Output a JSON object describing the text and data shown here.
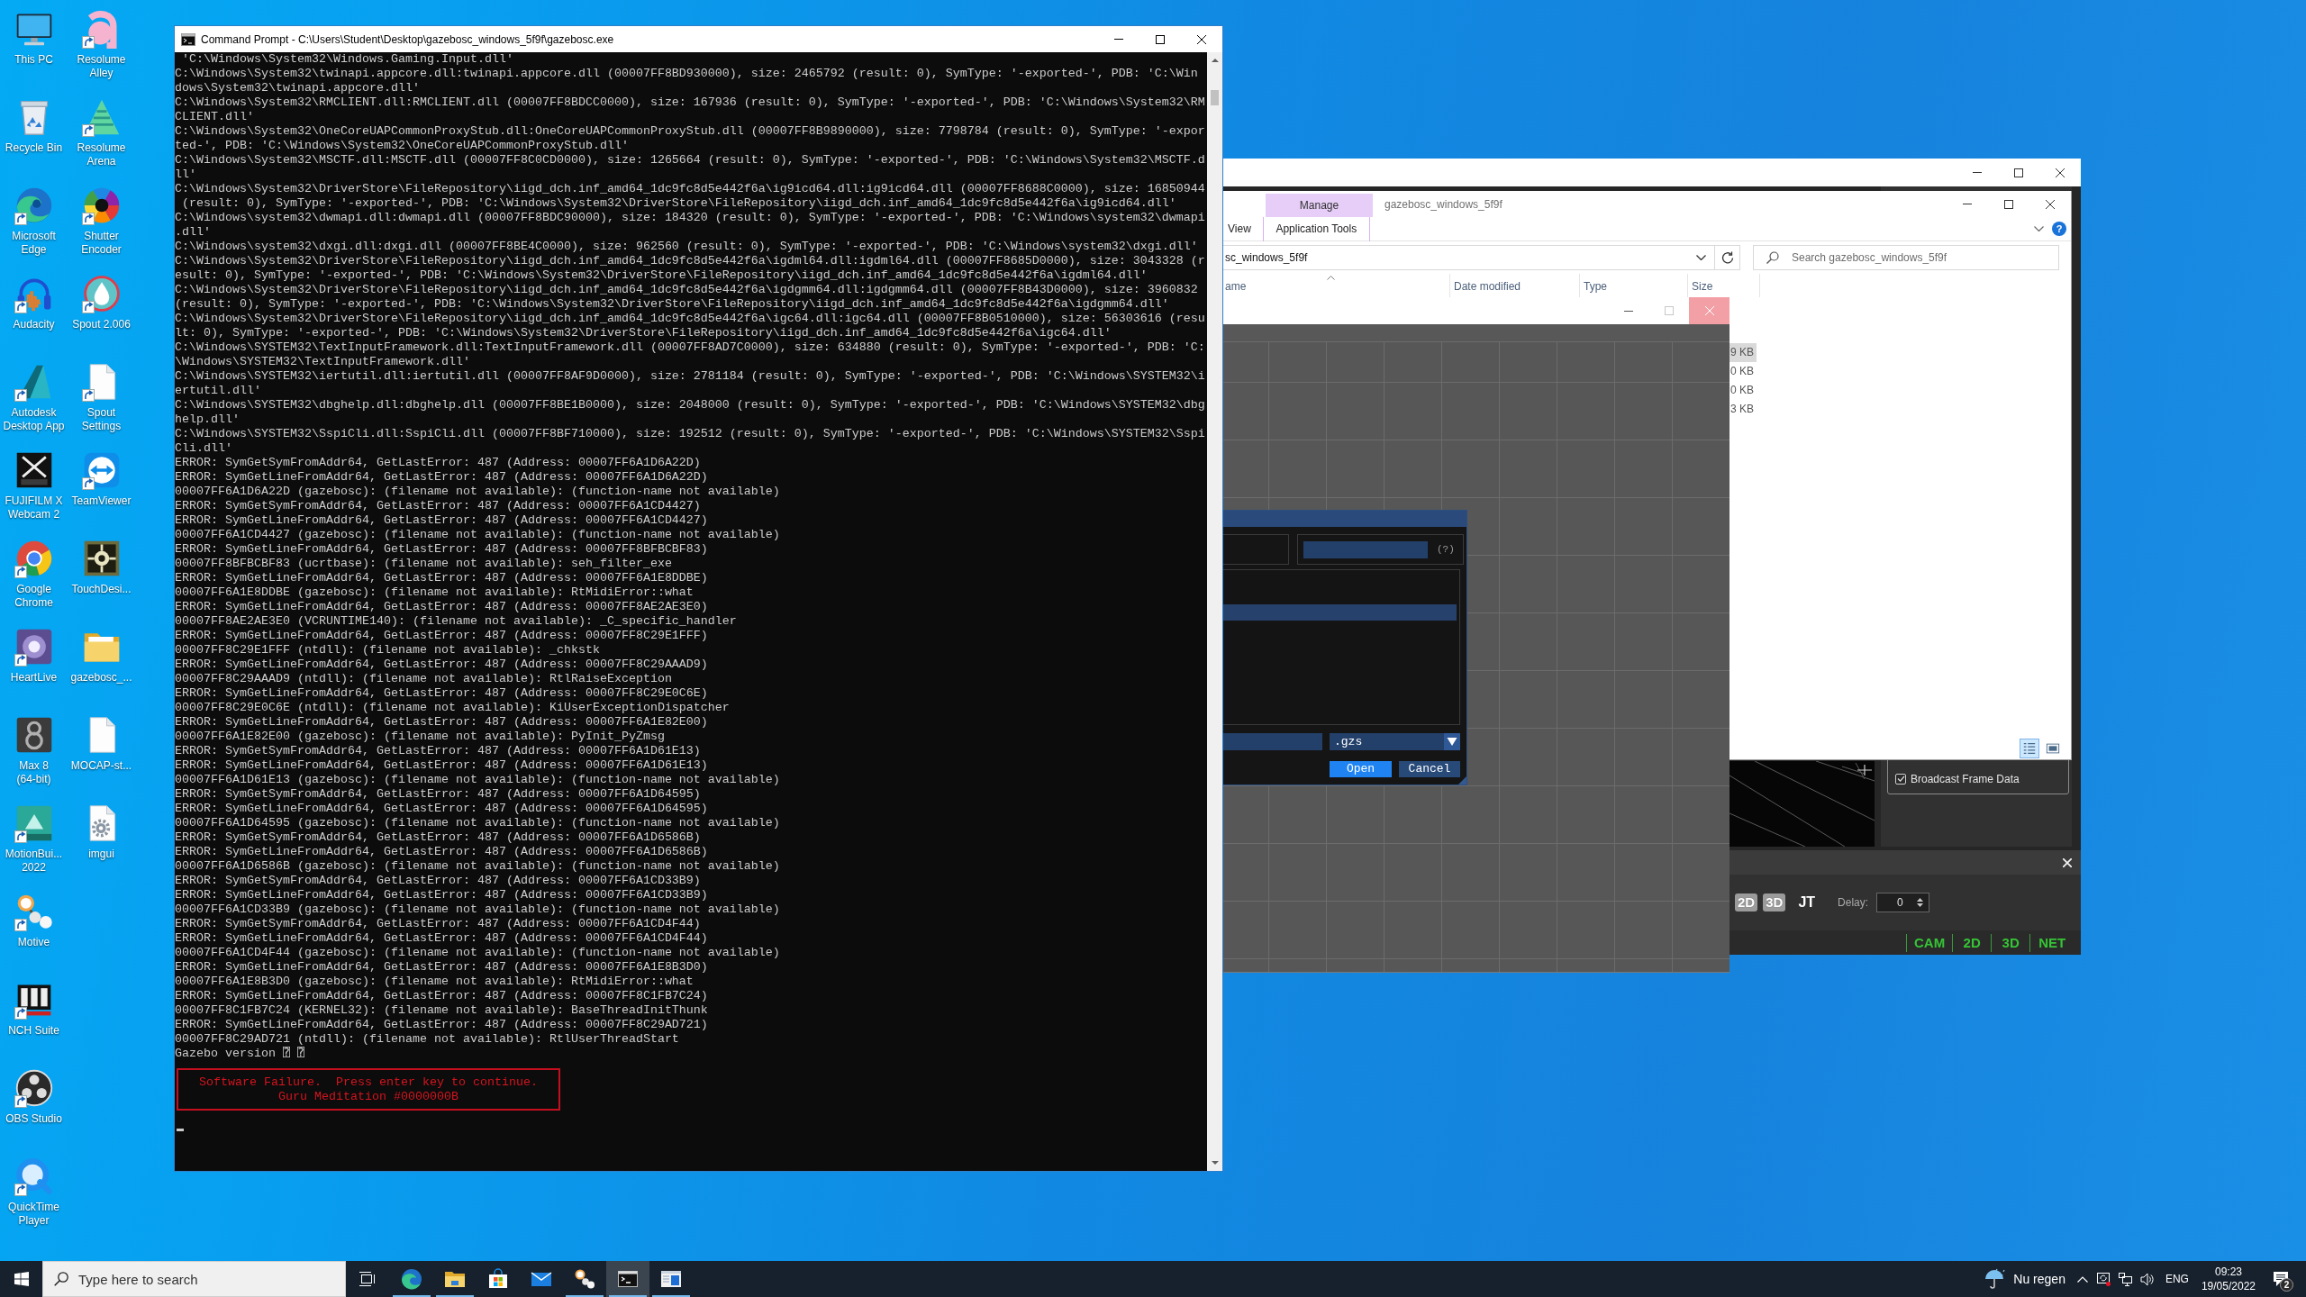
{
  "desktop_icons": [
    {
      "label": "This PC",
      "shortcut": false
    },
    {
      "label": "Recycle Bin",
      "shortcut": false
    },
    {
      "label": "Microsoft Edge",
      "shortcut": true
    },
    {
      "label": "Audacity",
      "shortcut": true
    },
    {
      "label": "Autodesk Desktop App",
      "shortcut": true
    },
    {
      "label": "FUJIFILM X Webcam 2",
      "shortcut": false
    },
    {
      "label": "Google Chrome",
      "shortcut": true
    },
    {
      "label": "HeartLive",
      "shortcut": true
    },
    {
      "label": "Max 8 (64-bit)",
      "shortcut": false
    },
    {
      "label": "MotionBui... 2022",
      "shortcut": true
    },
    {
      "label": "Motive",
      "shortcut": true
    },
    {
      "label": "NCH Suite",
      "shortcut": true
    },
    {
      "label": "OBS Studio",
      "shortcut": true
    },
    {
      "label": "QuickTime Player",
      "shortcut": true
    },
    {
      "label": "Resolume Alley",
      "shortcut": true
    },
    {
      "label": "Resolume Arena",
      "shortcut": true
    },
    {
      "label": "Shutter Encoder",
      "shortcut": true
    },
    {
      "label": "Spout 2.006",
      "shortcut": true
    },
    {
      "label": "Spout Settings",
      "shortcut": true
    },
    {
      "label": "TeamViewer",
      "shortcut": true
    },
    {
      "label": "TouchDesi...",
      "shortcut": false
    },
    {
      "label": "gazebosc_...",
      "shortcut": false
    },
    {
      "label": "MOCAP-st...",
      "shortcut": false
    },
    {
      "label": "imgui",
      "shortcut": false
    }
  ],
  "console": {
    "title": "Command Prompt - C:\\Users\\Student\\Desktop\\gazebosc_windows_5f9f\\gazebosc.exe",
    "lines": [
      " 'C:\\Windows\\System32\\Windows.Gaming.Input.dll'",
      "C:\\Windows\\System32\\twinapi.appcore.dll:twinapi.appcore.dll (00007FF8BD930000), size: 2465792 (result: 0), SymType: '-exported-', PDB: 'C:\\Win",
      "dows\\System32\\twinapi.appcore.dll'",
      "C:\\Windows\\System32\\RMCLIENT.dll:RMCLIENT.dll (00007FF8BDCC0000), size: 167936 (result: 0), SymType: '-exported-', PDB: 'C:\\Windows\\System32\\RM",
      "CLIENT.dll'",
      "C:\\Windows\\System32\\OneCoreUAPCommonProxyStub.dll:OneCoreUAPCommonProxyStub.dll (00007FF8B9890000), size: 7798784 (result: 0), SymType: '-expor",
      "ted-', PDB: 'C:\\Windows\\System32\\OneCoreUAPCommonProxyStub.dll'",
      "C:\\Windows\\System32\\MSCTF.dll:MSCTF.dll (00007FF8C0CD0000), size: 1265664 (result: 0), SymType: '-exported-', PDB: 'C:\\Windows\\System32\\MSCTF.d",
      "ll'",
      "C:\\Windows\\System32\\DriverStore\\FileRepository\\iigd_dch.inf_amd64_1dc9fc8d5e442f6a\\ig9icd64.dll:ig9icd64.dll (00007FF8688C0000), size: 16850944",
      " (result: 0), SymType: '-exported-', PDB: 'C:\\Windows\\System32\\DriverStore\\FileRepository\\iigd_dch.inf_amd64_1dc9fc8d5e442f6a\\ig9icd64.dll'",
      "C:\\Windows\\system32\\dwmapi.dll:dwmapi.dll (00007FF8BDC90000), size: 184320 (result: 0), SymType: '-exported-', PDB: 'C:\\Windows\\system32\\dwmapi",
      ".dll'",
      "C:\\Windows\\system32\\dxgi.dll:dxgi.dll (00007FF8BE4C0000), size: 962560 (result: 0), SymType: '-exported-', PDB: 'C:\\Windows\\system32\\dxgi.dll'",
      "C:\\Windows\\System32\\DriverStore\\FileRepository\\iigd_dch.inf_amd64_1dc9fc8d5e442f6a\\igdml64.dll:igdml64.dll (00007FF8685D0000), size: 3043328 (r",
      "esult: 0), SymType: '-exported-', PDB: 'C:\\Windows\\System32\\DriverStore\\FileRepository\\iigd_dch.inf_amd64_1dc9fc8d5e442f6a\\igdml64.dll'",
      "C:\\Windows\\System32\\DriverStore\\FileRepository\\iigd_dch.inf_amd64_1dc9fc8d5e442f6a\\igdgmm64.dll:igdgmm64.dll (00007FF8B43D0000), size: 3960832",
      "(result: 0), SymType: '-exported-', PDB: 'C:\\Windows\\System32\\DriverStore\\FileRepository\\iigd_dch.inf_amd64_1dc9fc8d5e442f6a\\igdgmm64.dll'",
      "C:\\Windows\\System32\\DriverStore\\FileRepository\\iigd_dch.inf_amd64_1dc9fc8d5e442f6a\\igc64.dll:igc64.dll (00007FF8B0510000), size: 56303616 (resu",
      "lt: 0), SymType: '-exported-', PDB: 'C:\\Windows\\System32\\DriverStore\\FileRepository\\iigd_dch.inf_amd64_1dc9fc8d5e442f6a\\igc64.dll'",
      "C:\\Windows\\SYSTEM32\\TextInputFramework.dll:TextInputFramework.dll (00007FF8AD7C0000), size: 634880 (result: 0), SymType: '-exported-', PDB: 'C:",
      "\\Windows\\SYSTEM32\\TextInputFramework.dll'",
      "C:\\Windows\\SYSTEM32\\iertutil.dll:iertutil.dll (00007FF8AF9D0000), size: 2781184 (result: 0), SymType: '-exported-', PDB: 'C:\\Windows\\SYSTEM32\\i",
      "ertutil.dll'",
      "C:\\Windows\\SYSTEM32\\dbghelp.dll:dbghelp.dll (00007FF8BE1B0000), size: 2048000 (result: 0), SymType: '-exported-', PDB: 'C:\\Windows\\SYSTEM32\\dbg",
      "help.dll'",
      "C:\\Windows\\SYSTEM32\\SspiCli.dll:SspiCli.dll (00007FF8BF710000), size: 192512 (result: 0), SymType: '-exported-', PDB: 'C:\\Windows\\SYSTEM32\\Sspi",
      "Cli.dll'",
      "ERROR: SymGetSymFromAddr64, GetLastError: 487 (Address: 00007FF6A1D6A22D)",
      "ERROR: SymGetLineFromAddr64, GetLastError: 487 (Address: 00007FF6A1D6A22D)",
      "00007FF6A1D6A22D (gazebosc): (filename not available): (function-name not available)",
      "ERROR: SymGetSymFromAddr64, GetLastError: 487 (Address: 00007FF6A1CD4427)",
      "ERROR: SymGetLineFromAddr64, GetLastError: 487 (Address: 00007FF6A1CD4427)",
      "00007FF6A1CD4427 (gazebosc): (filename not available): (function-name not available)",
      "ERROR: SymGetLineFromAddr64, GetLastError: 487 (Address: 00007FF8BFBCBF83)",
      "00007FF8BFBCBF83 (ucrtbase): (filename not available): seh_filter_exe",
      "ERROR: SymGetLineFromAddr64, GetLastError: 487 (Address: 00007FF6A1E8DDBE)",
      "00007FF6A1E8DDBE (gazebosc): (filename not available): RtMidiError::what",
      "ERROR: SymGetLineFromAddr64, GetLastError: 487 (Address: 00007FF8AE2AE3E0)",
      "00007FF8AE2AE3E0 (VCRUNTIME140): (filename not available): _C_specific_handler",
      "ERROR: SymGetLineFromAddr64, GetLastError: 487 (Address: 00007FF8C29E1FFF)",
      "00007FF8C29E1FFF (ntdll): (filename not available): _chkstk",
      "ERROR: SymGetLineFromAddr64, GetLastError: 487 (Address: 00007FF8C29AAAD9)",
      "00007FF8C29AAAD9 (ntdll): (filename not available): RtlRaiseException",
      "ERROR: SymGetLineFromAddr64, GetLastError: 487 (Address: 00007FF8C29E0C6E)",
      "00007FF8C29E0C6E (ntdll): (filename not available): KiUserExceptionDispatcher",
      "ERROR: SymGetLineFromAddr64, GetLastError: 487 (Address: 00007FF6A1E82E00)",
      "00007FF6A1E82E00 (gazebosc): (filename not available): PyInit_PyZmsg",
      "ERROR: SymGetSymFromAddr64, GetLastError: 487 (Address: 00007FF6A1D61E13)",
      "ERROR: SymGetLineFromAddr64, GetLastError: 487 (Address: 00007FF6A1D61E13)",
      "00007FF6A1D61E13 (gazebosc): (filename not available): (function-name not available)",
      "ERROR: SymGetSymFromAddr64, GetLastError: 487 (Address: 00007FF6A1D64595)",
      "ERROR: SymGetLineFromAddr64, GetLastError: 487 (Address: 00007FF6A1D64595)",
      "00007FF6A1D64595 (gazebosc): (filename not available): (function-name not available)",
      "ERROR: SymGetSymFromAddr64, GetLastError: 487 (Address: 00007FF6A1D6586B)",
      "ERROR: SymGetLineFromAddr64, GetLastError: 487 (Address: 00007FF6A1D6586B)",
      "00007FF6A1D6586B (gazebosc): (filename not available): (function-name not available)",
      "ERROR: SymGetSymFromAddr64, GetLastError: 487 (Address: 00007FF6A1CD33B9)",
      "ERROR: SymGetLineFromAddr64, GetLastError: 487 (Address: 00007FF6A1CD33B9)",
      "00007FF6A1CD33B9 (gazebosc): (filename not available): (function-name not available)",
      "ERROR: SymGetSymFromAddr64, GetLastError: 487 (Address: 00007FF6A1CD4F44)",
      "ERROR: SymGetLineFromAddr64, GetLastError: 487 (Address: 00007FF6A1CD4F44)",
      "00007FF6A1CD4F44 (gazebosc): (filename not available): (function-name not available)",
      "ERROR: SymGetLineFromAddr64, GetLastError: 487 (Address: 00007FF6A1E8B3D0)",
      "00007FF6A1E8B3D0 (gazebosc): (filename not available): RtMidiError::what",
      "ERROR: SymGetLineFromAddr64, GetLastError: 487 (Address: 00007FF8C1FB7C24)",
      "00007FF8C1FB7C24 (KERNEL32): (filename not available): BaseThreadInitThunk",
      "ERROR: SymGetLineFromAddr64, GetLastError: 487 (Address: 00007FF8C29AD721)",
      "00007FF8C29AD721 (ntdll): (filename not available): RtlUserThreadStart",
      "Gazebo version ⍰ ⍰"
    ],
    "alert": [
      "Software Failure.  Press enter key to continue.",
      "Guru Meditation #0000000B"
    ]
  },
  "app_window": {
    "broadcast_frame_data": {
      "label": "Broadcast Frame Data",
      "checked": true
    },
    "view_buttons": [
      {
        "label": "2D",
        "on": true
      },
      {
        "label": "3D",
        "on": true
      },
      {
        "label": "JT",
        "on": false
      }
    ],
    "delay": {
      "label": "Delay:",
      "value": "0"
    },
    "status": [
      "CAM",
      "2D",
      "3D",
      "NET"
    ]
  },
  "explorer": {
    "context_tab": "Manage",
    "title": "gazebosc_windows_5f9f",
    "tabs": [
      {
        "label": "View",
        "kind": "standard"
      },
      {
        "label": "Application Tools",
        "kind": "contextual"
      }
    ],
    "help": "?",
    "address": "sc_windows_5f9f",
    "search": {
      "placeholder": "Search gazebosc_windows_5f9f"
    },
    "columns": [
      "ame",
      "Date modified",
      "Type",
      "Size"
    ],
    "sizes": [
      {
        "text": "9 KB",
        "selected": true
      },
      {
        "text": "0 KB",
        "selected": false
      },
      {
        "text": "0 KB",
        "selected": false
      },
      {
        "text": "3 KB",
        "selected": false
      }
    ],
    "views": [
      {
        "selected": true
      },
      {
        "selected": false
      }
    ]
  },
  "node_window": {
    "file_dialog": {
      "help": "(?)",
      "rows": [
        {
          "selected": true
        }
      ],
      "file_type": ".gzs",
      "buttons": [
        {
          "label": "Open",
          "highlighted": true
        },
        {
          "label": "Cancel",
          "highlighted": false
        }
      ]
    }
  },
  "taskbar": {
    "search": {
      "placeholder": "Type here to search"
    },
    "apps": [
      {
        "selected": false,
        "running": true
      },
      {
        "selected": false,
        "running": true
      },
      {
        "selected": false,
        "running": false
      },
      {
        "selected": false,
        "running": false
      },
      {
        "selected": false,
        "running": true
      },
      {
        "selected": true,
        "running": true
      },
      {
        "selected": false,
        "running": true
      }
    ],
    "weather": "Nu regen",
    "language": "ENG",
    "time": "09:23",
    "date": "19/05/2022",
    "notifications": "2"
  }
}
